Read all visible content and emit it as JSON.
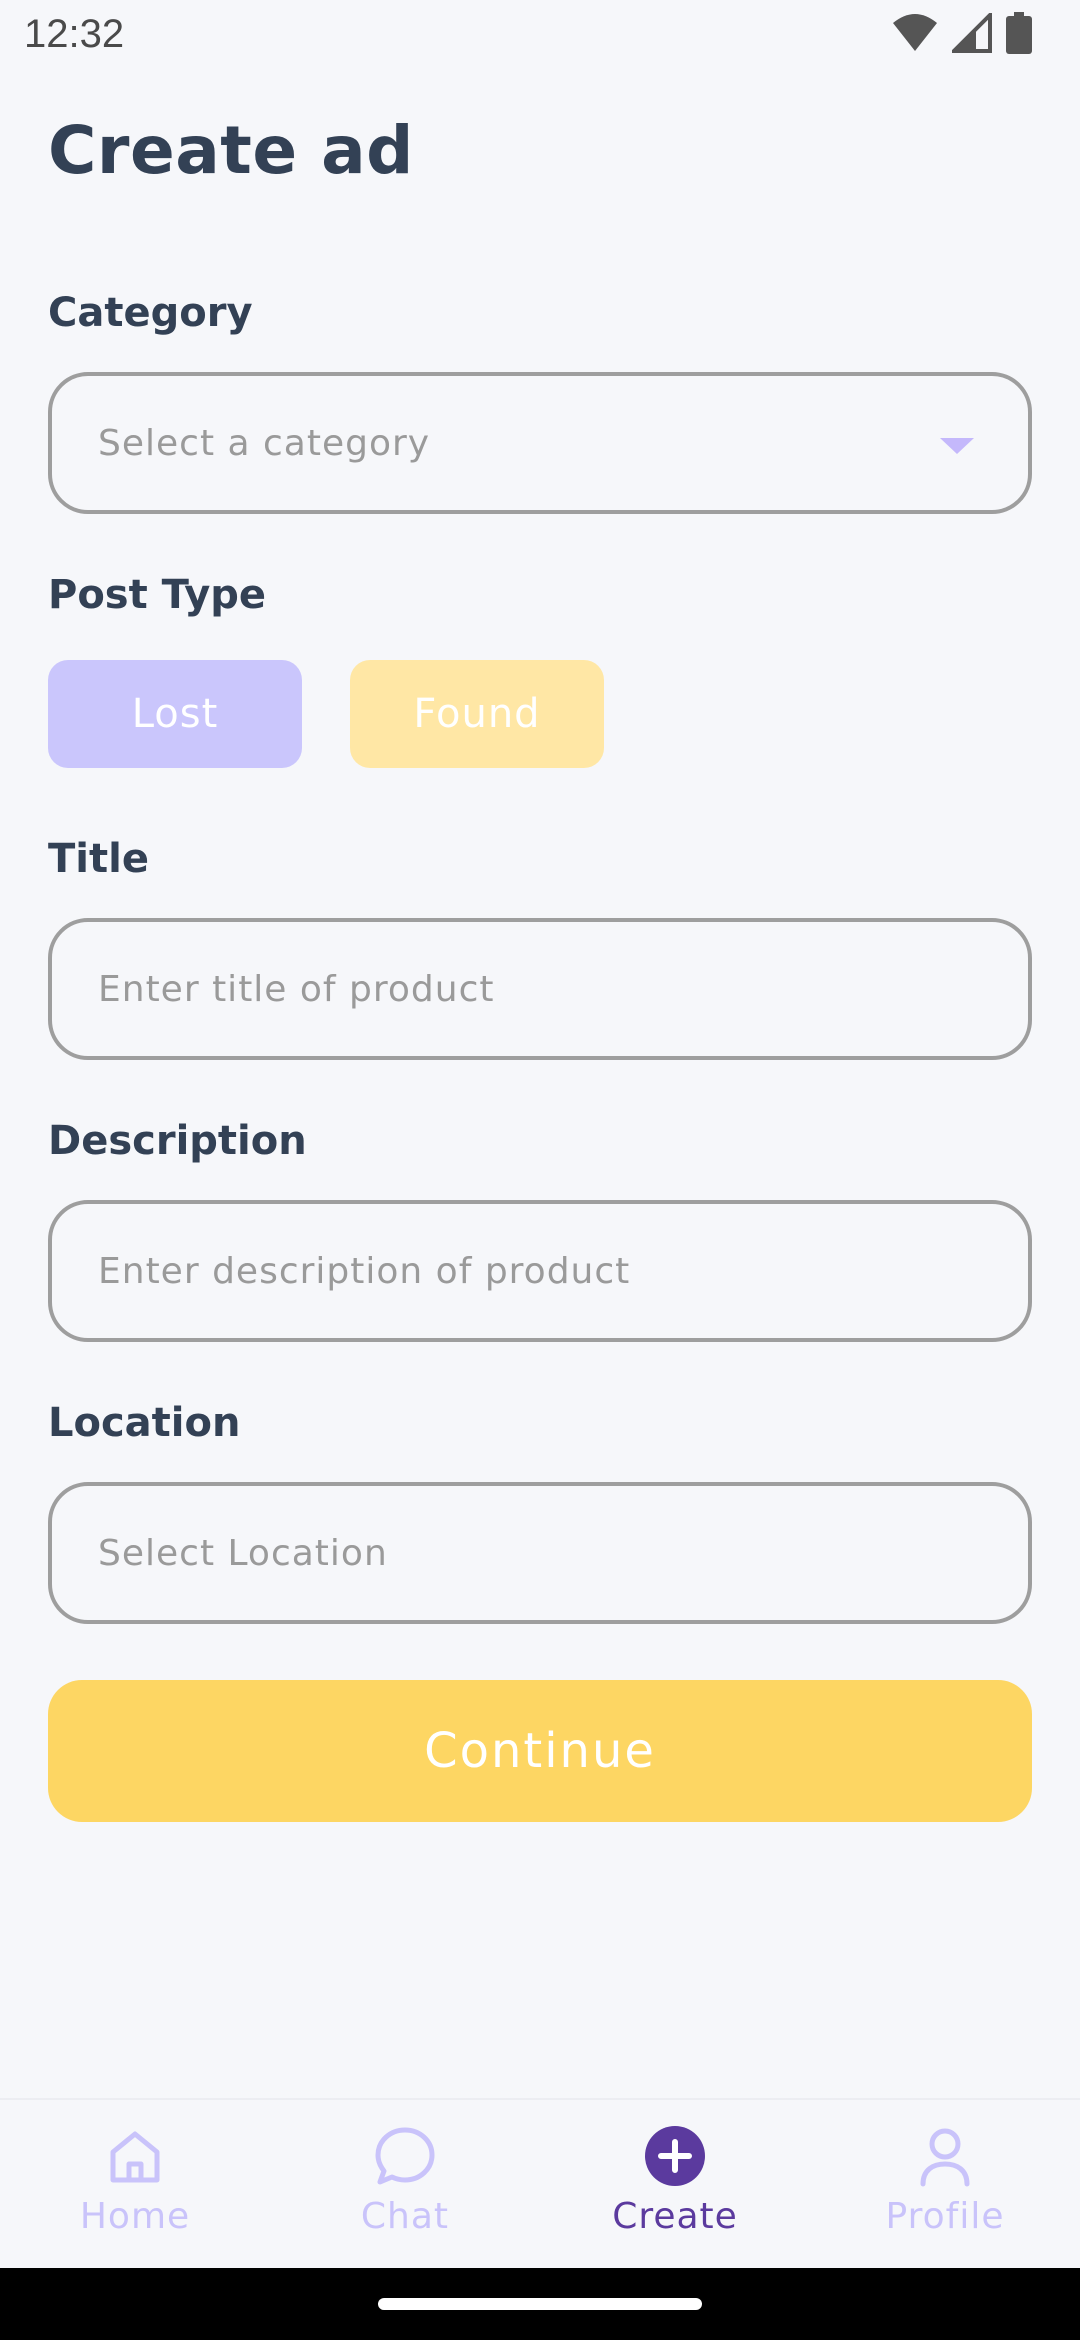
{
  "status_bar": {
    "time": "12:32"
  },
  "page": {
    "title": "Create ad"
  },
  "form": {
    "category": {
      "label": "Category",
      "placeholder": "Select a category"
    },
    "post_type": {
      "label": "Post Type",
      "options": [
        "Lost",
        "Found"
      ]
    },
    "title": {
      "label": "Title",
      "placeholder": "Enter title of product"
    },
    "description": {
      "label": "Description",
      "placeholder": "Enter description of product"
    },
    "location": {
      "label": "Location",
      "placeholder": "Select Location"
    },
    "continue_label": "Continue"
  },
  "nav": {
    "items": [
      {
        "label": "Home",
        "icon": "home-icon"
      },
      {
        "label": "Chat",
        "icon": "chat-icon"
      },
      {
        "label": "Create",
        "icon": "plus-circle-icon",
        "active": true
      },
      {
        "label": "Profile",
        "icon": "person-icon"
      }
    ]
  },
  "colors": {
    "accent_purple": "#5B3A9E",
    "lost_button": "#CAC6FC",
    "found_button": "#FFE7A5",
    "continue_button": "#FDD663",
    "inactive_nav": "#C9C3FA"
  }
}
